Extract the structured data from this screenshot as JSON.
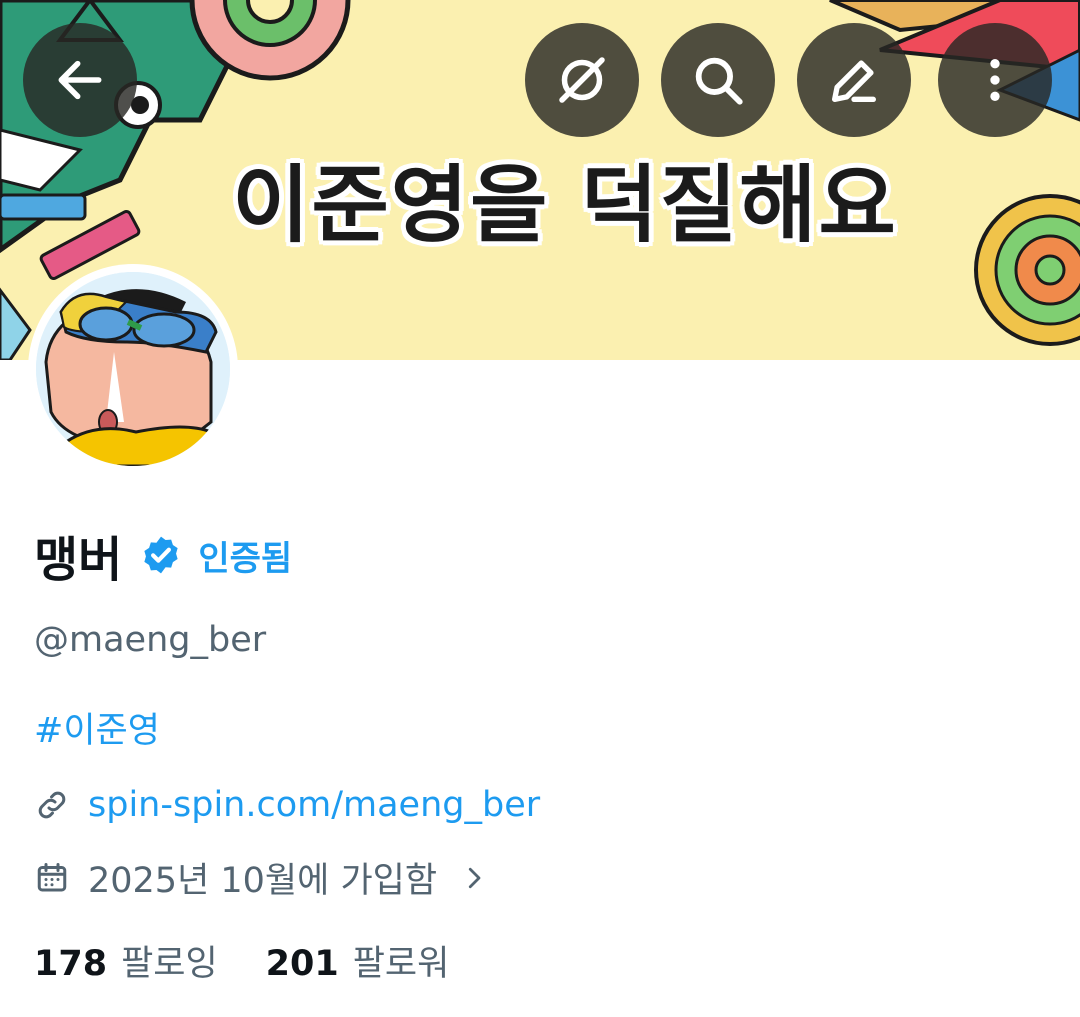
{
  "banner": {
    "title": "이준영을 덕질해요"
  },
  "header_actions": {
    "back": "back-arrow-icon",
    "grok": "grok-icon",
    "search": "search-icon",
    "edit": "edit-icon",
    "more": "more-vertical-icon"
  },
  "profile": {
    "display_name": "맹버",
    "verified_label": "인증됨",
    "handle": "@maeng_ber",
    "bio_hashtag": "#이준영",
    "website": "spin-spin.com/maeng_ber",
    "joined": "2025년 10월에 가입함",
    "following_count": "178",
    "following_label": "팔로잉",
    "followers_count": "201",
    "followers_label": "팔로워"
  },
  "colors": {
    "accent": "#1d9bf0",
    "secondary_text": "#536471",
    "banner_bg": "#fbf0b0"
  }
}
